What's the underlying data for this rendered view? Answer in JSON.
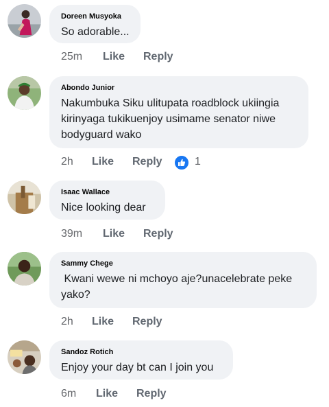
{
  "comments": [
    {
      "author": "Doreen Musyoka",
      "text": "So adorable...",
      "time": "25m",
      "like_label": "Like",
      "reply_label": "Reply"
    },
    {
      "author": "Abondo Junior",
      "text": "Nakumbuka Siku ulitupata roadblock ukiingia kirinyaga tukikuenjoy usimame senator niwe bodyguard wako",
      "time": "2h",
      "like_label": "Like",
      "reply_label": "Reply",
      "reactions": {
        "icon": "like-reaction-icon",
        "count": "1"
      }
    },
    {
      "author": "Isaac Wallace",
      "text": "Nice looking dear",
      "time": "39m",
      "like_label": "Like",
      "reply_label": "Reply"
    },
    {
      "author": "Sammy Chege",
      "text": " Kwani wewe ni mchoyo aje?unacelebrate peke yako?",
      "time": "2h",
      "like_label": "Like",
      "reply_label": "Reply"
    },
    {
      "author": "Sandoz Rotich",
      "text": "Enjoy your day bt can I join you",
      "time": "6m",
      "like_label": "Like",
      "reply_label": "Reply"
    }
  ],
  "colors": {
    "bubble": "#f0f2f5",
    "meta_text": "#65676b",
    "like_reaction": "#1877f2"
  }
}
